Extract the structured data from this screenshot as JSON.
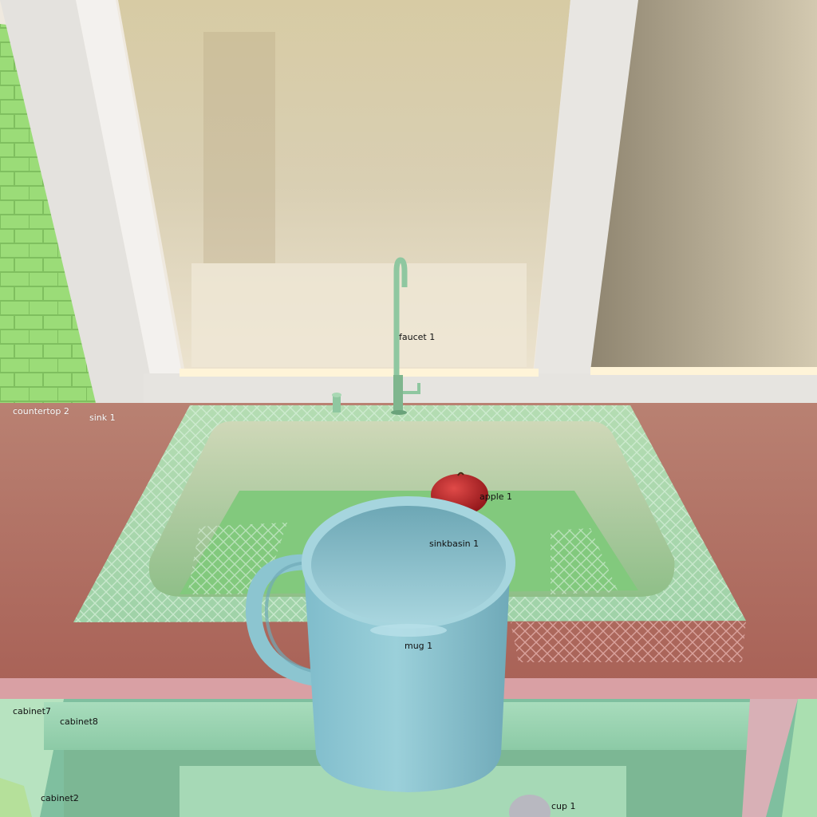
{
  "scene": {
    "objects": [
      {
        "id": "faucet",
        "label": "faucet 1",
        "tone": "dark"
      },
      {
        "id": "countertop",
        "label": "countertop 2",
        "tone": "light"
      },
      {
        "id": "sink",
        "label": "sink 1",
        "tone": "light"
      },
      {
        "id": "apple",
        "label": "apple 1",
        "tone": "dark"
      },
      {
        "id": "sinkbasin",
        "label": "sinkbasin 1",
        "tone": "dark"
      },
      {
        "id": "mug",
        "label": "mug 1",
        "tone": "dark"
      },
      {
        "id": "cabinet7",
        "label": "cabinet7",
        "tone": "dark"
      },
      {
        "id": "cabinet8",
        "label": "cabinet8",
        "tone": "dark"
      },
      {
        "id": "cabinet2",
        "label": "cabinet2",
        "tone": "dark"
      },
      {
        "id": "cup",
        "label": "cup 1",
        "tone": "dark"
      }
    ]
  },
  "colors": {
    "countertop": "#b06d60",
    "sink_steel": "#9fd0a5",
    "basin_floor": "#7fc87a",
    "mug": "#8fc6d0",
    "apple": "#c0242c",
    "wall_tile": "#9bdc78",
    "window_frame": "#e8e6e2",
    "cabinet": "#9fd8b4"
  }
}
